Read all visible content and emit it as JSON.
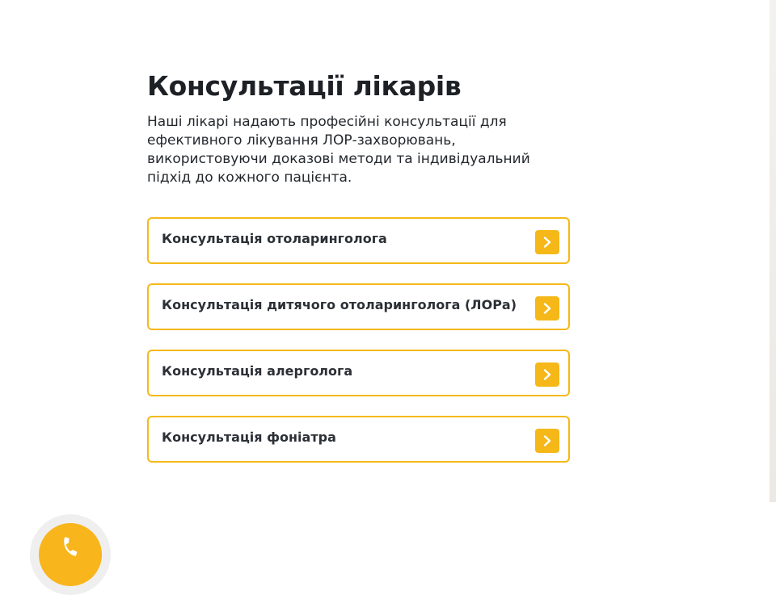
{
  "section": {
    "title": "Консультації лікарів",
    "description": "Наші лікарі надають професійні консультації для ефективного лікування ЛОР-захворювань, використовуючи доказові методи та індивідуальний підхід до кожного пацієнта."
  },
  "consultations": [
    {
      "label": "Консультація отоларинголога",
      "icon": "chevron-right-icon"
    },
    {
      "label": "Консультація дитячого отоларинголога (ЛОРа)",
      "icon": "chevron-right-icon"
    },
    {
      "label": "Консультація алерголога",
      "icon": "chevron-right-icon"
    },
    {
      "label": "Консультація фоніатра",
      "icon": "chevron-right-icon"
    }
  ],
  "phone_widget": {
    "icon": "phone-icon"
  },
  "colors": {
    "accent": "#f5b818",
    "heading": "#1d2126",
    "text": "#24282d",
    "phone_ring": "#efefef"
  }
}
